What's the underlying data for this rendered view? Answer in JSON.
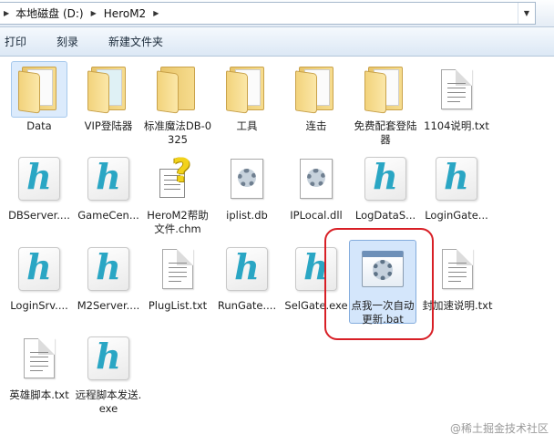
{
  "address_bar": {
    "crumbs": [
      "本地磁盘 (D:)",
      "HeroM2"
    ]
  },
  "toolbar": {
    "buttons": [
      "打印",
      "刻录",
      "新建文件夹"
    ]
  },
  "files": [
    {
      "label": "Data",
      "icon": "folder-icon"
    },
    {
      "label": "VIP登陆器",
      "icon": "folder-icon"
    },
    {
      "label": "标准魔法DB-0325",
      "icon": "folder-icon"
    },
    {
      "label": "工具",
      "icon": "folder-icon"
    },
    {
      "label": "连击",
      "icon": "folder-icon"
    },
    {
      "label": "免费配套登陆器",
      "icon": "folder-icon"
    },
    {
      "label": "1104说明.txt",
      "icon": "text-document-icon"
    },
    {
      "label": "DBServer....",
      "icon": "hero-app-icon"
    },
    {
      "label": "GameCen...",
      "icon": "hero-app-icon"
    },
    {
      "label": "HeroM2帮助文件.chm",
      "icon": "help-file-icon"
    },
    {
      "label": "iplist.db",
      "icon": "settings-file-icon"
    },
    {
      "label": "IPLocal.dll",
      "icon": "settings-file-icon"
    },
    {
      "label": "LogDataS...",
      "icon": "hero-app-icon"
    },
    {
      "label": "LoginGate...",
      "icon": "hero-app-icon"
    },
    {
      "label": "LoginSrv....",
      "icon": "hero-app-icon"
    },
    {
      "label": "M2Server....",
      "icon": "hero-app-icon"
    },
    {
      "label": "PlugList.txt",
      "icon": "text-document-icon"
    },
    {
      "label": "RunGate....",
      "icon": "hero-app-icon"
    },
    {
      "label": "SelGate.exe",
      "icon": "hero-app-icon"
    },
    {
      "label": "点我一次自动更新.bat",
      "icon": "batch-file-icon"
    },
    {
      "label": "封加速说明.txt",
      "icon": "text-document-icon"
    },
    {
      "label": "英雄脚本.txt",
      "icon": "text-document-icon"
    },
    {
      "label": "远程脚本发送.exe",
      "icon": "hero-app-icon"
    }
  ],
  "watermark": "@稀土掘金技术社区",
  "colors": {
    "highlight_ring": "#d81f26",
    "selection": "#dcebfc",
    "hero_icon": "#2aa6c4"
  }
}
